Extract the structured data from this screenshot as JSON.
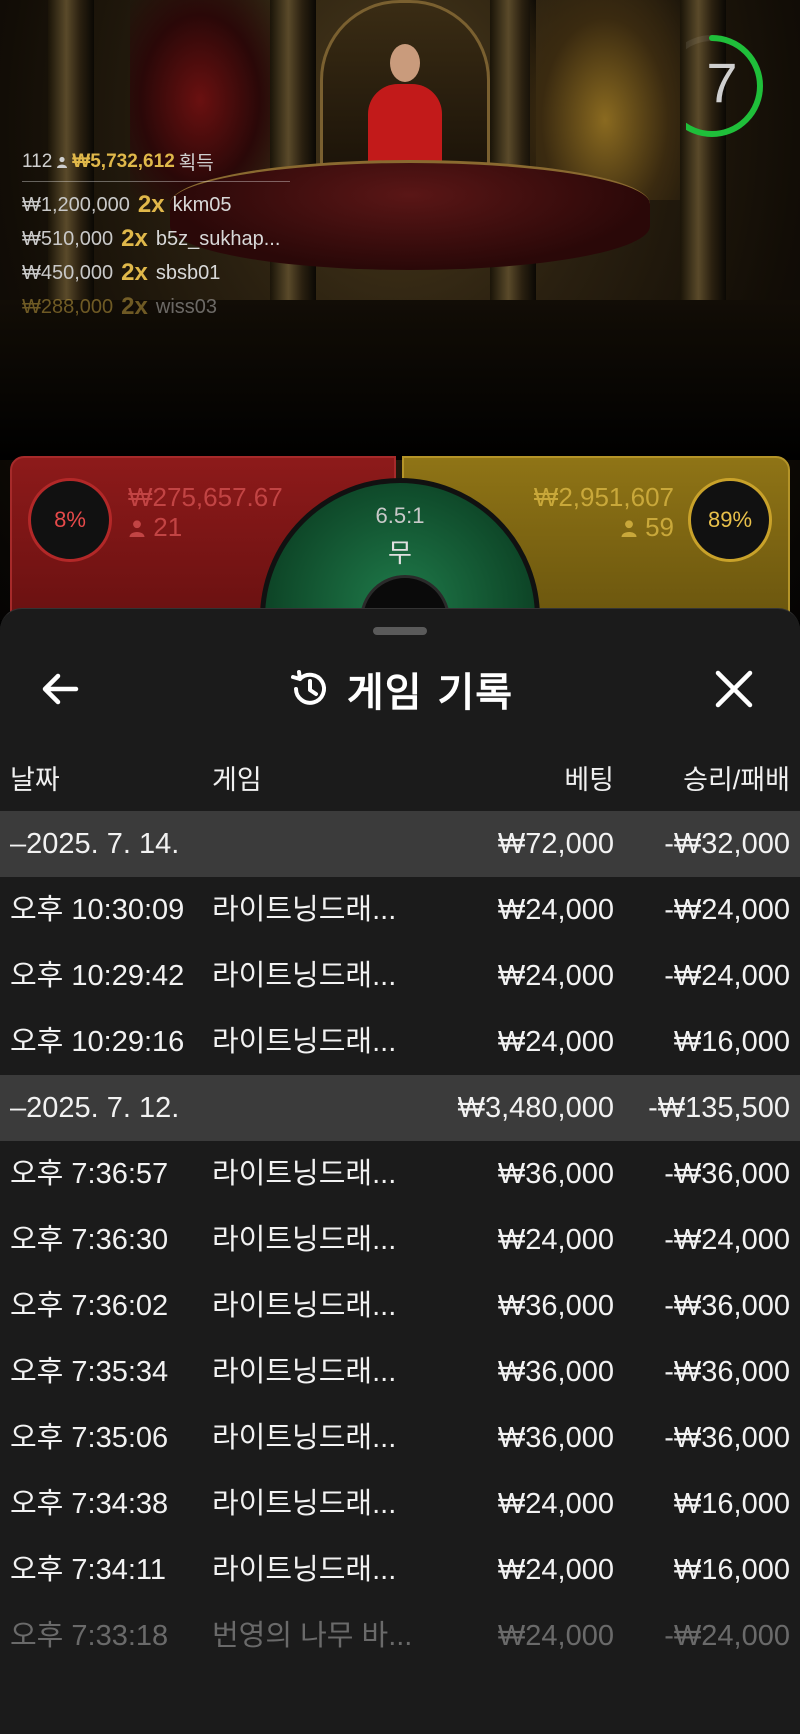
{
  "scene": {
    "timer": "7",
    "timer_progress": 0.82,
    "winners_summary": {
      "players": "112",
      "total": "₩5,732,612",
      "suffix": "획득"
    },
    "winners": [
      {
        "amount": "₩1,200,000",
        "mult": "2x",
        "name": "kkm05"
      },
      {
        "amount": "₩510,000",
        "mult": "2x",
        "name": "b5z_sukhap..."
      },
      {
        "amount": "₩450,000",
        "mult": "2x",
        "name": "sbsb01"
      },
      {
        "amount": "₩288,000",
        "mult": "2x",
        "name": "wiss03"
      }
    ],
    "dragon": {
      "percent": "8%",
      "amount": "₩275,657.67",
      "players": "21"
    },
    "tiger": {
      "percent": "89%",
      "amount": "₩2,951,607",
      "players": "59"
    },
    "tie": {
      "ratio": "6.5:1",
      "label": "무"
    }
  },
  "sheet": {
    "title": "게임 기록",
    "icons": {
      "back": "arrow-left-icon",
      "history": "history-icon",
      "close": "close-icon"
    },
    "columns": {
      "date": "날짜",
      "game": "게임",
      "bet": "베팅",
      "win": "승리/패배"
    },
    "rows": [
      {
        "type": "group",
        "date": "–2025. 7. 14.",
        "game": "",
        "bet": "₩72,000",
        "win": "-₩32,000"
      },
      {
        "type": "item",
        "date": "오후 10:30:09",
        "game": "라이트닝드래...",
        "bet": "₩24,000",
        "win": "-₩24,000"
      },
      {
        "type": "item",
        "date": "오후 10:29:42",
        "game": "라이트닝드래...",
        "bet": "₩24,000",
        "win": "-₩24,000"
      },
      {
        "type": "item",
        "date": "오후 10:29:16",
        "game": "라이트닝드래...",
        "bet": "₩24,000",
        "win": "₩16,000"
      },
      {
        "type": "group",
        "date": "–2025. 7. 12.",
        "game": "",
        "bet": "₩3,480,000",
        "win": "-₩135,500"
      },
      {
        "type": "item",
        "date": "오후 7:36:57",
        "game": "라이트닝드래...",
        "bet": "₩36,000",
        "win": "-₩36,000"
      },
      {
        "type": "item",
        "date": "오후 7:36:30",
        "game": "라이트닝드래...",
        "bet": "₩24,000",
        "win": "-₩24,000"
      },
      {
        "type": "item",
        "date": "오후 7:36:02",
        "game": "라이트닝드래...",
        "bet": "₩36,000",
        "win": "-₩36,000"
      },
      {
        "type": "item",
        "date": "오후 7:35:34",
        "game": "라이트닝드래...",
        "bet": "₩36,000",
        "win": "-₩36,000"
      },
      {
        "type": "item",
        "date": "오후 7:35:06",
        "game": "라이트닝드래...",
        "bet": "₩36,000",
        "win": "-₩36,000"
      },
      {
        "type": "item",
        "date": "오후 7:34:38",
        "game": "라이트닝드래...",
        "bet": "₩24,000",
        "win": "₩16,000"
      },
      {
        "type": "item",
        "date": "오후 7:34:11",
        "game": "라이트닝드래...",
        "bet": "₩24,000",
        "win": "₩16,000"
      },
      {
        "type": "item muted",
        "date": "오후 7:33:18",
        "game": "번영의 나무 바...",
        "bet": "₩24,000",
        "win": "-₩24,000"
      }
    ]
  },
  "colors": {
    "sheet_bg": "#1b1b1b",
    "group_row_bg": "#3b3b3b",
    "gold": "#e0b84a",
    "dragon_red": "#8d1a1a",
    "tiger_gold": "#8f7416",
    "timer_green": "#1fbf3a"
  }
}
